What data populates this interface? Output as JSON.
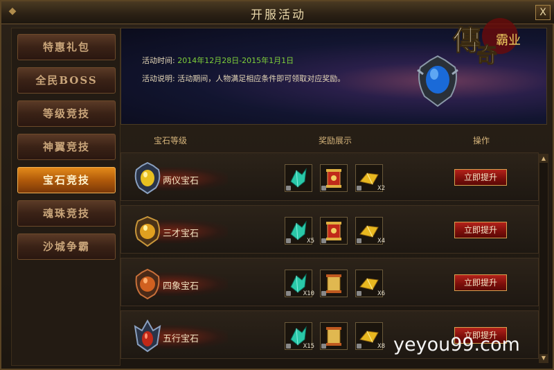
{
  "window": {
    "title": "开服活动",
    "close_label": "X"
  },
  "sidebar": {
    "items": [
      {
        "label": "特惠礼包",
        "active": false
      },
      {
        "label": "全民BOSS",
        "active": false
      },
      {
        "label": "等级竞技",
        "active": false
      },
      {
        "label": "神翼竞技",
        "active": false
      },
      {
        "label": "宝石竞技",
        "active": true
      },
      {
        "label": "魂珠竞技",
        "active": false
      },
      {
        "label": "沙城争霸",
        "active": false
      }
    ]
  },
  "banner": {
    "time_label": "活动时间:",
    "time_value": "2014年12月28日-2015年1月1日",
    "desc_label": "活动说明:",
    "desc_value": "活动期间，人物满足相应条件即可领取对应奖励。",
    "logo_text_main": "傳奇",
    "logo_text_sub": "霸业"
  },
  "table": {
    "col_gem": "宝石等级",
    "col_reward": "奖励展示",
    "col_action": "操作",
    "rows": [
      {
        "gem": "两仪宝石",
        "gem_color": "#e8c020",
        "rewards": [
          {
            "icon": "crystal-icon",
            "qty": ""
          },
          {
            "icon": "red-scroll-icon",
            "qty": ""
          },
          {
            "icon": "gold-bar-icon",
            "qty": "X2"
          }
        ],
        "button": "立即提升"
      },
      {
        "gem": "三才宝石",
        "gem_color": "#e0a020",
        "rewards": [
          {
            "icon": "crystal-icon",
            "qty": "X5"
          },
          {
            "icon": "red-scroll-icon",
            "qty": ""
          },
          {
            "icon": "gold-bar-icon",
            "qty": "X4"
          }
        ],
        "button": "立即提升"
      },
      {
        "gem": "四象宝石",
        "gem_color": "#d06020",
        "rewards": [
          {
            "icon": "crystal-icon",
            "qty": "X10"
          },
          {
            "icon": "gold-scroll-icon",
            "qty": ""
          },
          {
            "icon": "gold-bar-icon",
            "qty": "X6"
          }
        ],
        "button": "立即提升"
      },
      {
        "gem": "五行宝石",
        "gem_color": "#c02818",
        "rewards": [
          {
            "icon": "crystal-icon",
            "qty": "X15"
          },
          {
            "icon": "gold-scroll-icon",
            "qty": ""
          },
          {
            "icon": "gold-bar-icon",
            "qty": "X8"
          }
        ],
        "button": "立即提升"
      }
    ]
  },
  "watermark": "yeyou99.com"
}
